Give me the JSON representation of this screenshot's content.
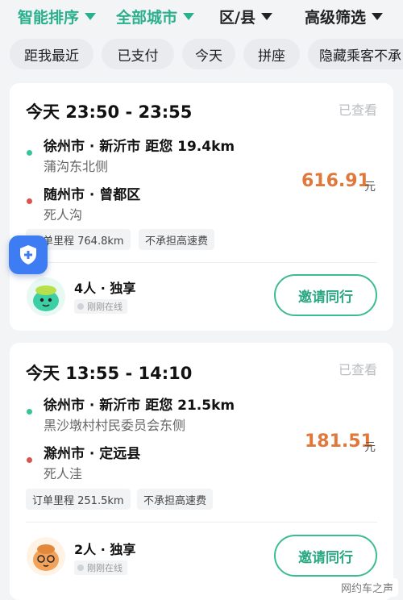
{
  "filters": [
    {
      "label": "智能排序",
      "active": true
    },
    {
      "label": "全部城市",
      "active": true
    },
    {
      "label": "区/县",
      "active": false
    },
    {
      "label": "高级筛选",
      "active": false
    }
  ],
  "chips": [
    "距我最近",
    "已支付",
    "今天",
    "拼座",
    "隐藏乘客不承"
  ],
  "orders": [
    {
      "time": "今天 23:50 - 23:55",
      "seen": "已查看",
      "from_city": "徐州市 · 新沂市 距您 19.4km",
      "from_place": "蒲沟东北侧",
      "to_city": "随州市 · 曾都区",
      "to_place": "死人沟",
      "price": "616.91",
      "unit": "元",
      "distance_tag": "订单里程 764.8km",
      "toll_tag": "不承担高速费",
      "passengers": "4人 · 独享",
      "online_status": "刚刚在线",
      "invite_label": "邀请同行"
    },
    {
      "time": "今天 13:55 - 14:10",
      "seen": "已查看",
      "from_city": "徐州市 · 新沂市 距您 21.5km",
      "from_place": "黑沙墩村村民委员会东侧",
      "to_city": "滁州市 · 定远县",
      "to_place": "死人洼",
      "price": "181.51",
      "unit": "元",
      "distance_tag": "订单里程 251.5km",
      "toll_tag": "不承担高速费",
      "passengers": "2人 · 独享",
      "online_status": "刚刚在线",
      "invite_label": "邀请同行"
    }
  ],
  "watermark": "网约车之声",
  "colors": {
    "accent": "#2bb08e",
    "price": "#e0783c",
    "shield": "#3d7cf2"
  }
}
